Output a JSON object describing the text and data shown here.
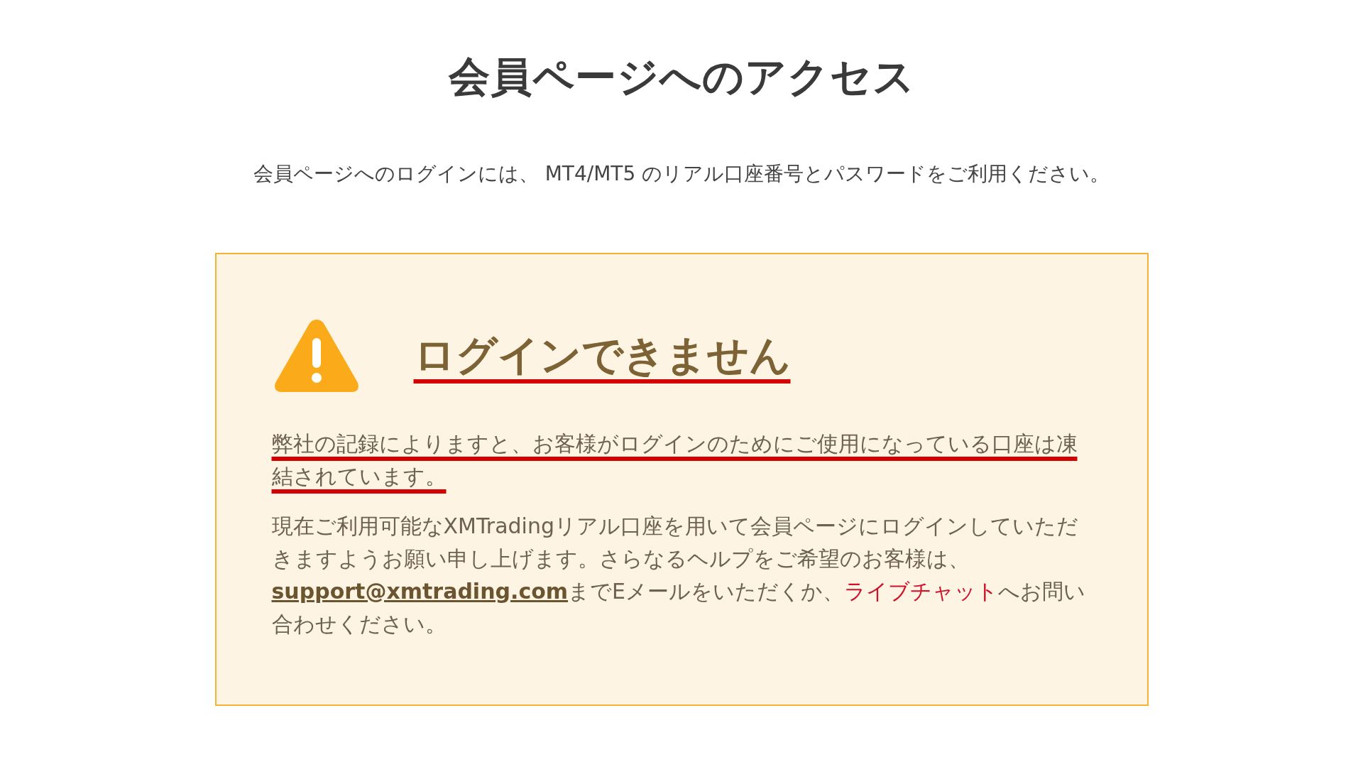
{
  "page_title": "会員ページへのアクセス",
  "intro": "会員ページへのログインには、 MT4/MT5 のリアル口座番号とパスワードをご利用ください。",
  "alert": {
    "heading": {
      "text": "ログインできません",
      "highlighted": true
    },
    "message": {
      "text": "弊社の記録によりますと、お客様がログインのためにご使用になっている口座は凍結されています。",
      "highlighted": true
    },
    "help": [
      {
        "kind": "text",
        "text": "現在ご利用可能なXMTradingリアル口座を用いて会員ページにログインしていただきますようお願い申し上げます。さらなるヘルプをご希望のお客様は、"
      },
      {
        "kind": "email",
        "text": "support@xmtrading.com"
      },
      {
        "kind": "text",
        "text": "までEメールをいただくか、"
      },
      {
        "kind": "chat",
        "text": "ライブチャット"
      },
      {
        "kind": "text",
        "text": "へお問い合わせください。"
      }
    ]
  }
}
